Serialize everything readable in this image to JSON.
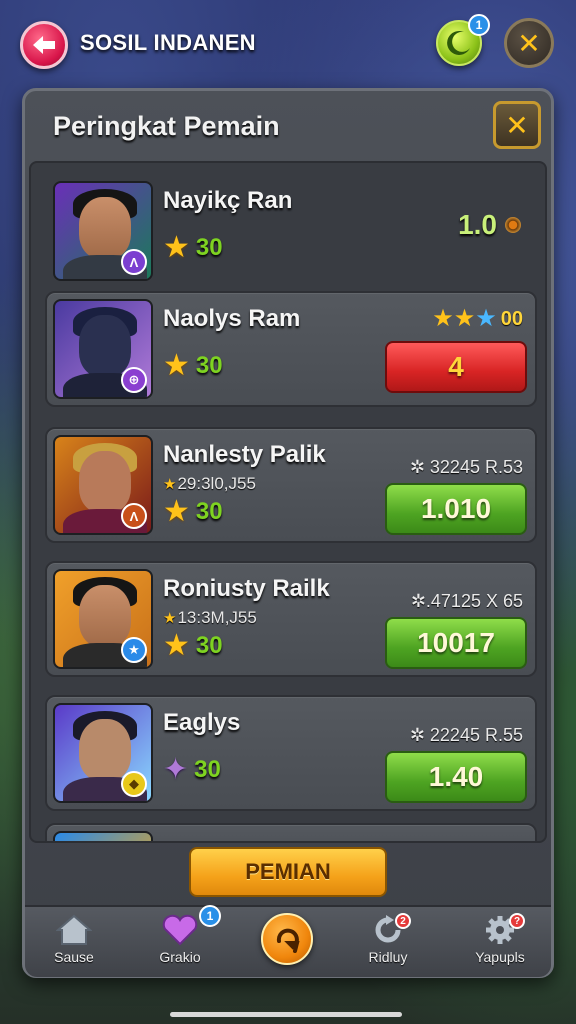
{
  "header": {
    "title": "SOSIL INDANEN",
    "moon_badge": "1",
    "close_glyph": "✕"
  },
  "panel": {
    "title": "Peringkat Pemain",
    "close_glyph": "✕"
  },
  "players": [
    {
      "name": "Nayikç Ran",
      "level": "30",
      "score": "1.0",
      "icon": "coin-icon",
      "colors": {
        "bg1": "#6a2fb8",
        "bg2": "#1b7a5a",
        "emblem": "#7b3fd0"
      },
      "emblem_glyph": "Λ"
    },
    {
      "name": "Naolys Ram",
      "level": "30",
      "star_count": "00",
      "button": "4",
      "button_style": "red",
      "colors": {
        "bg1": "#4a3aa0",
        "bg2": "#b07ad8",
        "emblem": "#8a3fd0"
      },
      "emblem_glyph": "⊕"
    },
    {
      "name": "Nanlesty Palik",
      "subtext": "29:3l0,J55",
      "level": "30",
      "stat": "✲ 32245 R.53",
      "button": "1.010",
      "button_style": "green",
      "colors": {
        "bg1": "#d8831a",
        "bg2": "#7a1a1a",
        "emblem": "#c8501a"
      },
      "emblem_glyph": "Λ"
    },
    {
      "name": "Roniusty Railk",
      "subtext": "13:3M,J55",
      "level": "30",
      "stat": "✲.47125 X 65",
      "button": "10017",
      "button_style": "green",
      "colors": {
        "bg1": "#f0a02a",
        "bg2": "#c8701a",
        "emblem": "#2a8ae8"
      },
      "emblem_glyph": "★"
    },
    {
      "name": "Eaglys",
      "level": "30",
      "stat": "✲ 22245 R.55",
      "button": "1.40",
      "button_style": "green",
      "colors": {
        "bg1": "#5a3ac8",
        "bg2": "#8ad8ff",
        "emblem": "#e8c81a"
      },
      "emblem_glyph": "◆"
    }
  ],
  "main_button": "PEMIAN",
  "nav": [
    {
      "label": "Sause",
      "icon": "home-icon"
    },
    {
      "label": "Grakio",
      "icon": "heart-icon",
      "badge": "1"
    },
    {
      "label": "",
      "icon": "swirl-icon"
    },
    {
      "label": "Ridluy",
      "icon": "refresh-icon",
      "badge": "2"
    },
    {
      "label": "Yapupls",
      "icon": "gear-icon",
      "badge": "?"
    }
  ]
}
